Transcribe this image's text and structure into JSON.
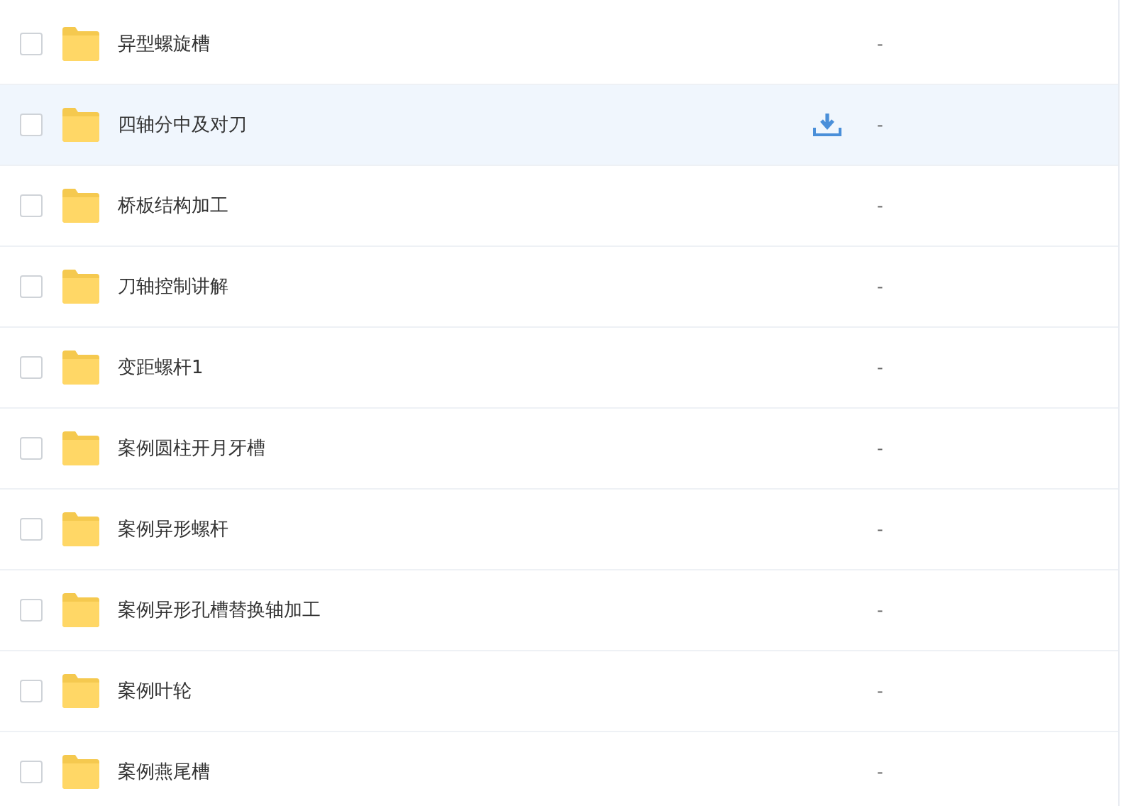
{
  "rows": [
    {
      "name": "异型螺旋槽",
      "size": "-",
      "checked": false,
      "highlighted": false
    },
    {
      "name": "四轴分中及对刀",
      "size": "-",
      "checked": false,
      "highlighted": true
    },
    {
      "name": "桥板结构加工",
      "size": "-",
      "checked": false,
      "highlighted": false
    },
    {
      "name": "刀轴控制讲解",
      "size": "-",
      "checked": false,
      "highlighted": false
    },
    {
      "name": "变距螺杆1",
      "size": "-",
      "checked": false,
      "highlighted": false
    },
    {
      "name": "案例圆柱开月牙槽",
      "size": "-",
      "checked": false,
      "highlighted": false
    },
    {
      "name": "案例异形螺杆",
      "size": "-",
      "checked": false,
      "highlighted": false
    },
    {
      "name": "案例异形孔槽替换轴加工",
      "size": "-",
      "checked": false,
      "highlighted": false
    },
    {
      "name": "案例叶轮",
      "size": "-",
      "checked": false,
      "highlighted": false
    },
    {
      "name": "案例燕尾槽",
      "size": "-",
      "checked": false,
      "highlighted": false
    }
  ]
}
